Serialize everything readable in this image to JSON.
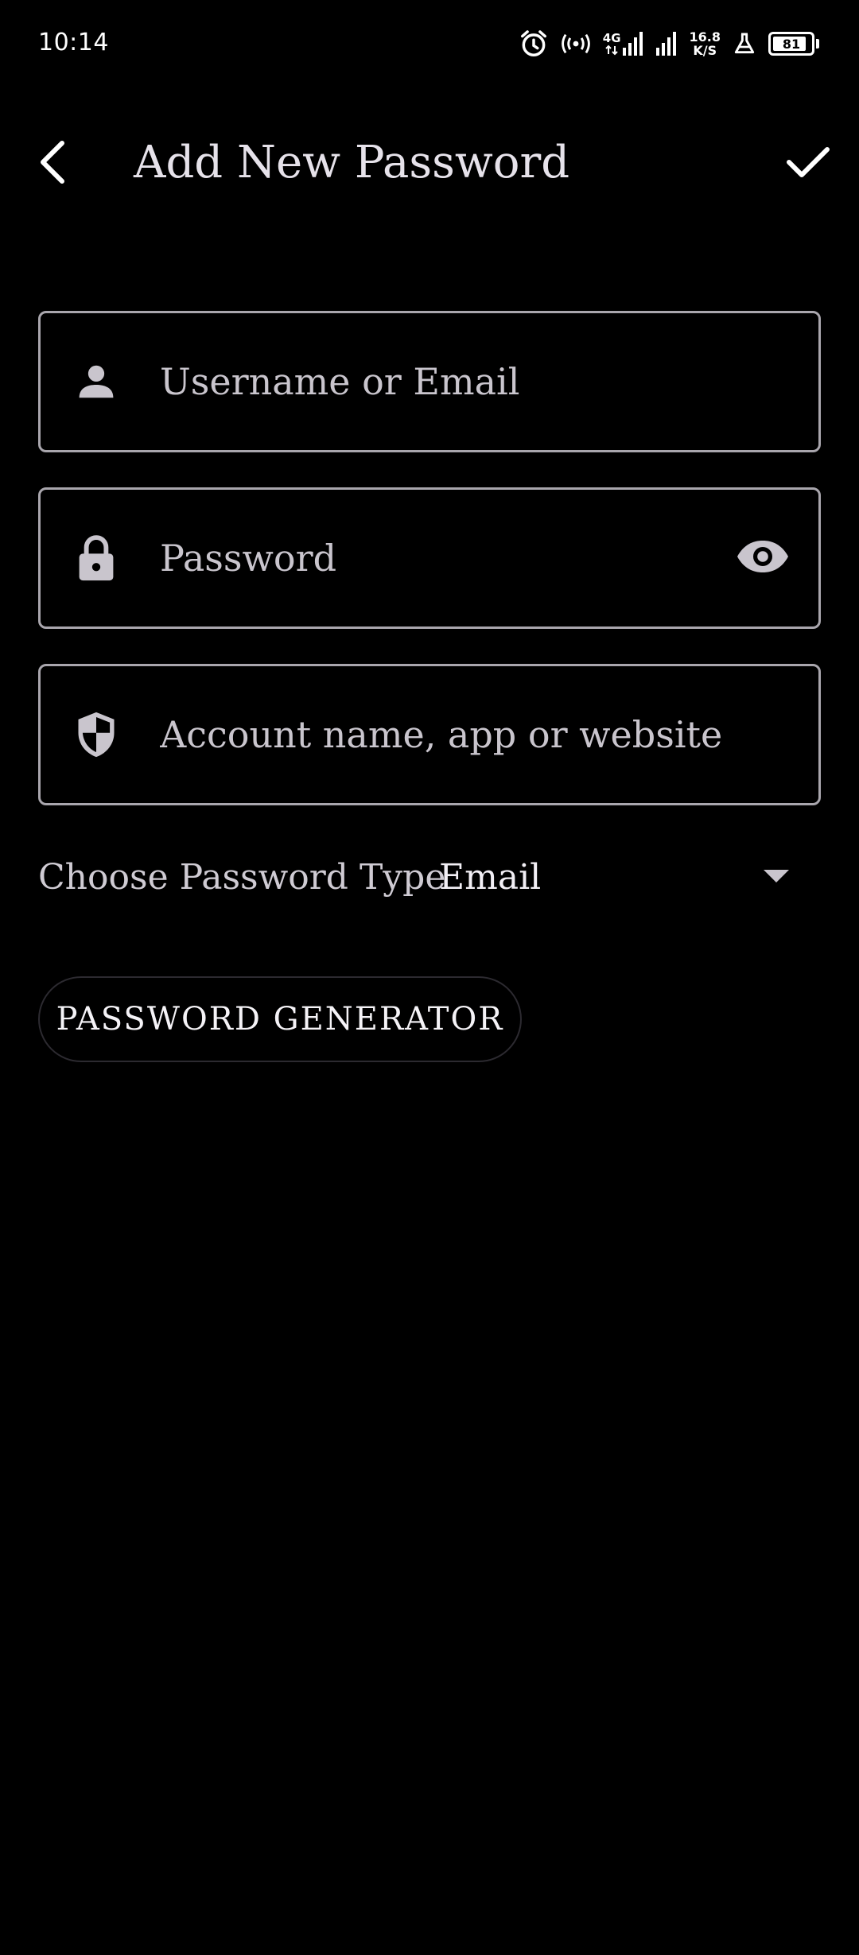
{
  "status_bar": {
    "time": "10:14",
    "network_type": "4G",
    "net_speed_value": "16.8",
    "net_speed_unit": "K/S",
    "battery_level": "81",
    "icons": [
      "alarm-icon",
      "hotspot-icon",
      "signal-4g-icon",
      "signal-icon",
      "flask-icon",
      "battery-icon"
    ]
  },
  "app_bar": {
    "title": "Add New Password",
    "back_icon": "chevron-left-icon",
    "confirm_icon": "check-icon"
  },
  "form": {
    "username": {
      "placeholder": "Username or Email",
      "value": "",
      "icon": "person-icon"
    },
    "password": {
      "placeholder": "Password",
      "value": "",
      "icon": "lock-icon",
      "toggle_icon": "eye-icon"
    },
    "account": {
      "placeholder": "Account name, app or website",
      "value": "",
      "icon": "shield-icon"
    },
    "password_type": {
      "label": "Choose Password Type",
      "selected": "Email",
      "arrow_icon": "dropdown-arrow-icon"
    },
    "generator_button_label": "PASSWORD GENERATOR"
  },
  "colors": {
    "background": "#000000",
    "outline": "#a9a6ad",
    "icon": "#c9c5cd",
    "text_primary": "#e6e2ea"
  }
}
